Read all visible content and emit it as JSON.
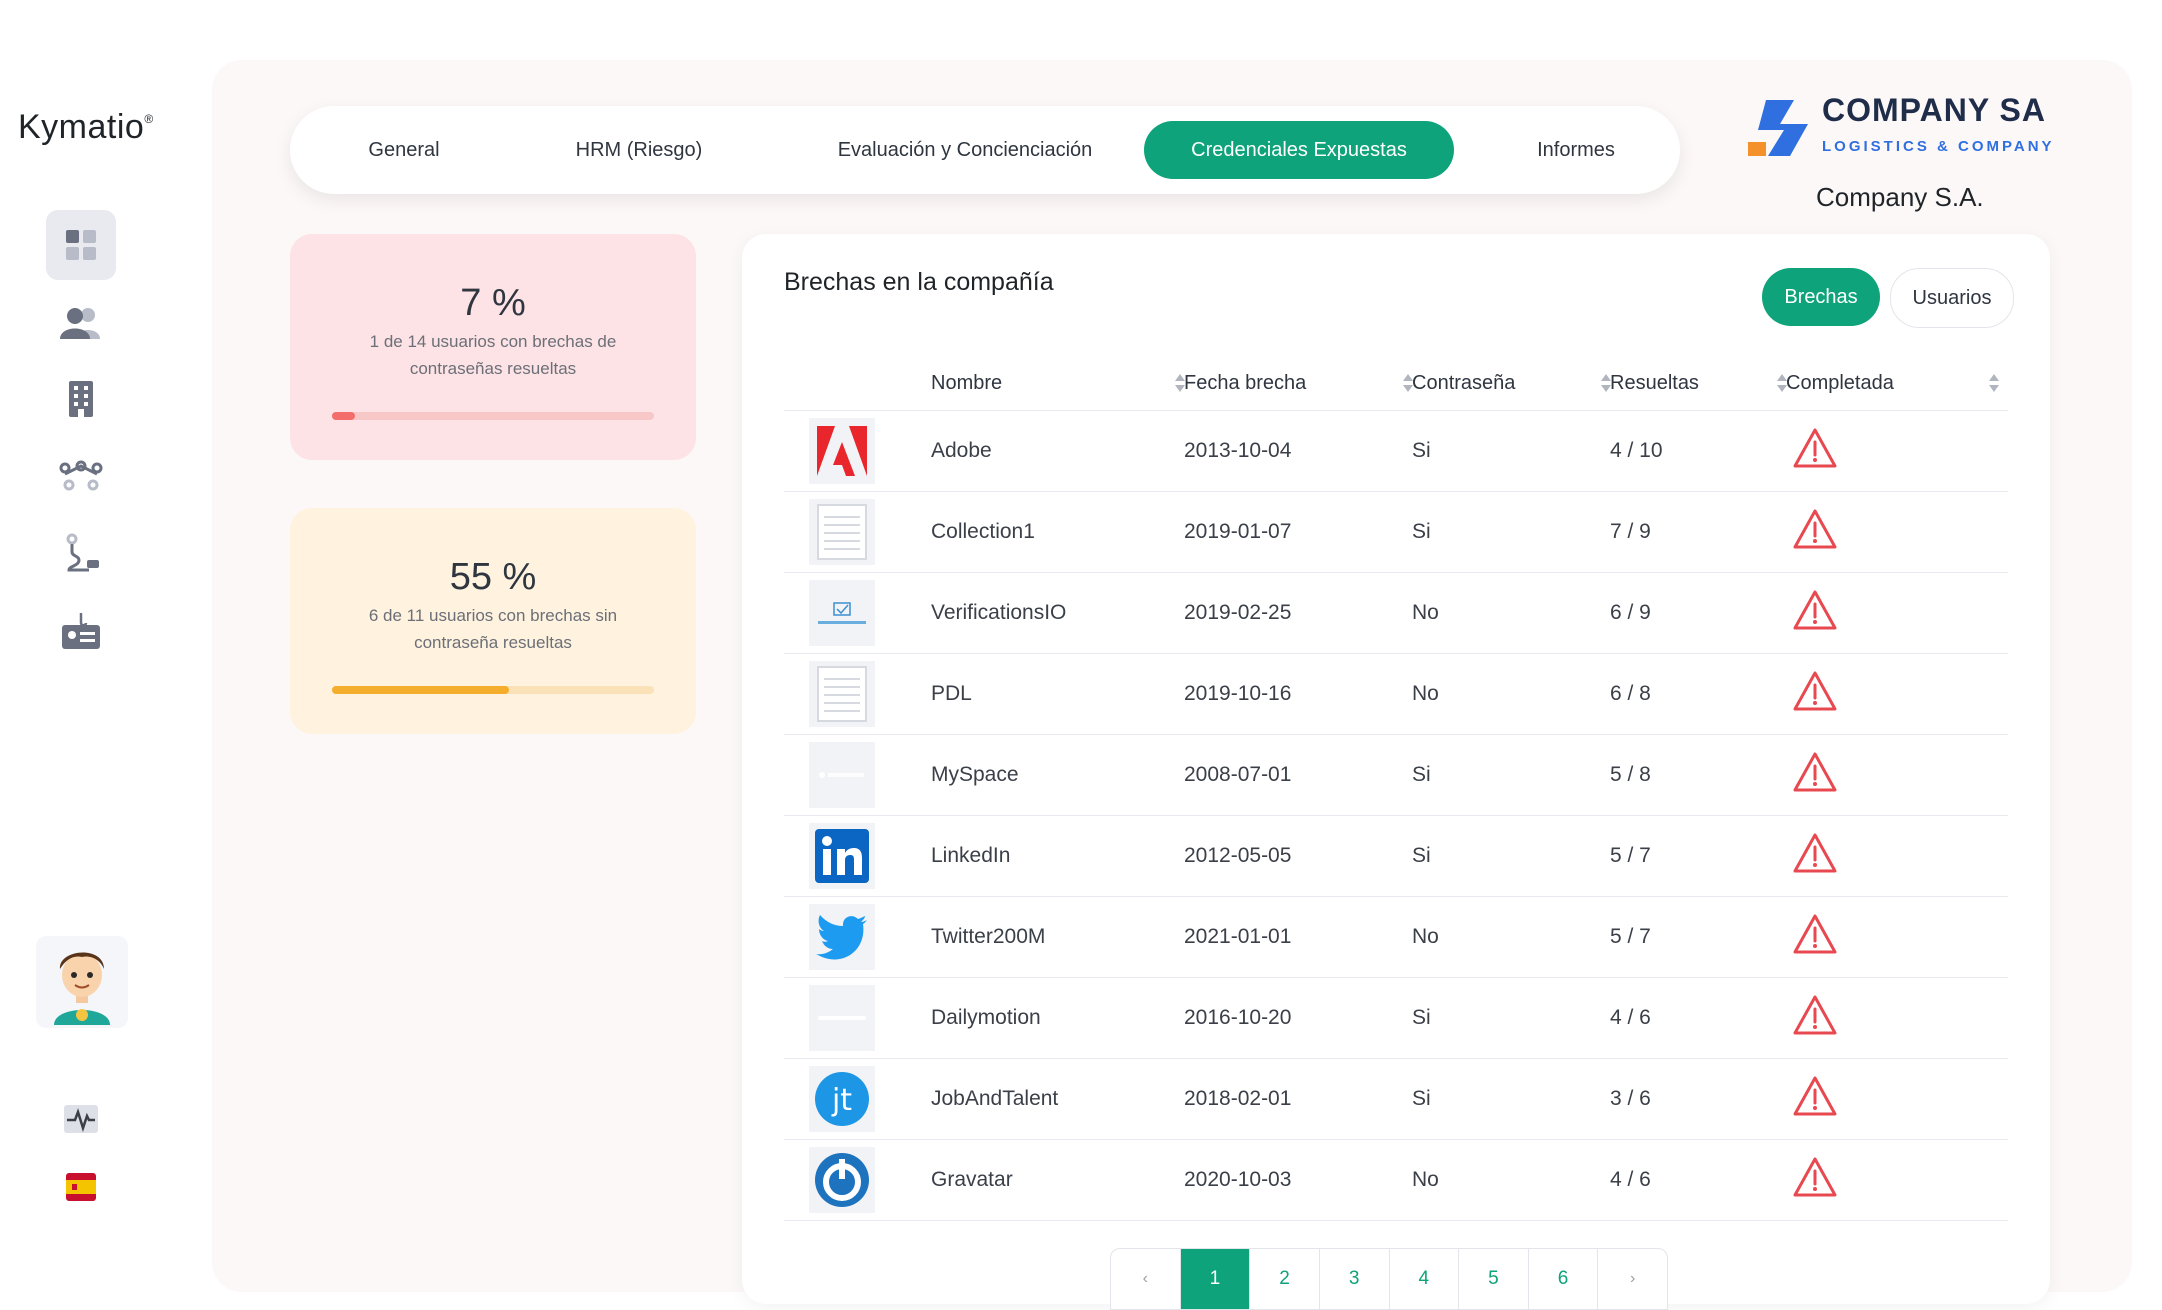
{
  "brand": {
    "name": "Kymatio",
    "mark": "®"
  },
  "nav": {
    "tabs": [
      {
        "label": "General"
      },
      {
        "label": "HRM (Riesgo)"
      },
      {
        "label": "Evaluación y Concienciación"
      },
      {
        "label": "Credenciales Expuestas",
        "active": true
      },
      {
        "label": "Informes"
      }
    ]
  },
  "company": {
    "logo_main": "COMPANY SA",
    "logo_sub": "LOGISTICS & COMPANY",
    "name": "Company S.A."
  },
  "stats": [
    {
      "percent": "7 %",
      "description": "1 de 14 usuarios con brechas de contraseñas resueltas",
      "progress": 0.07,
      "color": "#f46d6d",
      "track": "#f8c8c8",
      "bg": "#fde3e5"
    },
    {
      "percent": "55 %",
      "description": "6 de 11 usuarios con brechas sin contraseña resueltas",
      "progress": 0.55,
      "color": "#f5ae2c",
      "track": "#fbe1b8",
      "bg": "#fff3df"
    }
  ],
  "panel": {
    "title": "Brechas en la compañía",
    "toggle": {
      "on_label": "Brechas",
      "off_label": "Usuarios"
    },
    "columns": [
      "Nombre",
      "Fecha brecha",
      "Contraseña",
      "Resueltas",
      "Completada"
    ],
    "rows": [
      {
        "logo": "adobe-logo",
        "name": "Adobe",
        "date": "2013-10-04",
        "password": "Si",
        "resolved": "4 / 10"
      },
      {
        "logo": "generic-document-logo",
        "name": "Collection1",
        "date": "2019-01-07",
        "password": "Si",
        "resolved": "7 / 9"
      },
      {
        "logo": "verificationsio-logo",
        "name": "VerificationsIO",
        "date": "2019-02-25",
        "password": "No",
        "resolved": "6 / 9"
      },
      {
        "logo": "generic-document-logo",
        "name": "PDL",
        "date": "2019-10-16",
        "password": "No",
        "resolved": "6 / 8"
      },
      {
        "logo": "myspace-logo",
        "name": "MySpace",
        "date": "2008-07-01",
        "password": "Si",
        "resolved": "5 / 8"
      },
      {
        "logo": "linkedin-logo",
        "name": "LinkedIn",
        "date": "2012-05-05",
        "password": "Si",
        "resolved": "5 / 7"
      },
      {
        "logo": "twitter-logo",
        "name": "Twitter200M",
        "date": "2021-01-01",
        "password": "No",
        "resolved": "5 / 7"
      },
      {
        "logo": "dailymotion-logo",
        "name": "Dailymotion",
        "date": "2016-10-20",
        "password": "Si",
        "resolved": "4 / 6"
      },
      {
        "logo": "jobandtalent-logo",
        "name": "JobAndTalent",
        "date": "2018-02-01",
        "password": "Si",
        "resolved": "3 / 6"
      },
      {
        "logo": "gravatar-logo",
        "name": "Gravatar",
        "date": "2020-10-03",
        "password": "No",
        "resolved": "4 / 6"
      }
    ]
  },
  "pagination": {
    "prev": "‹",
    "pages": [
      "1",
      "2",
      "3",
      "4",
      "5",
      "6"
    ],
    "next": "›",
    "current": "1"
  },
  "colors": {
    "accent": "#0ea37a",
    "warning": "#e8484f"
  }
}
